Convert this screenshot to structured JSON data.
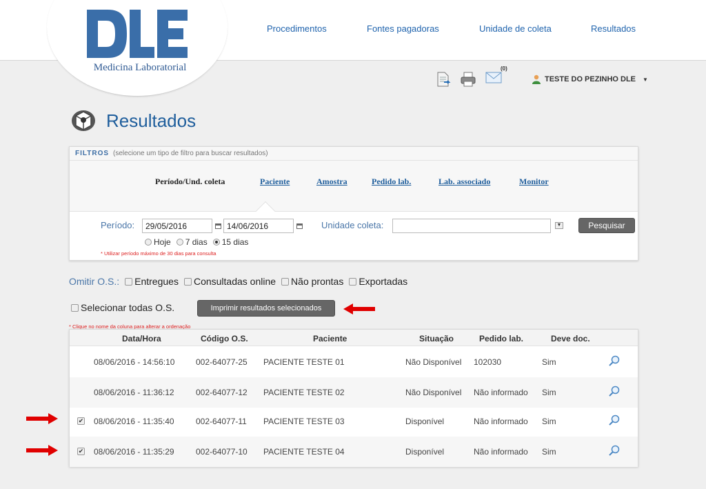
{
  "logo": {
    "text": "DLE",
    "subtitle": "Medicina Laboratorial",
    "color": "#3a6ea9"
  },
  "nav": [
    "Procedimentos",
    "Fontes pagadoras",
    "Unidade de coleta",
    "Resultados"
  ],
  "toolbar": {
    "messages_count": "(0)"
  },
  "user": {
    "name": "TESTE DO PEZINHO DLE"
  },
  "page": {
    "title": "Resultados"
  },
  "filters": {
    "heading": "FILTROS",
    "hint": "(selecione um tipo de filtro para buscar resultados)",
    "tabs": [
      "Período/Und. coleta",
      "Paciente",
      "Amostra",
      "Pedido lab.",
      "Lab. associado",
      "Monitor"
    ],
    "active_tab": "Período/Und. coleta",
    "period_label": "Período:",
    "date_from": "29/05/2016",
    "date_to": "14/06/2016",
    "unit_label": "Unidade coleta:",
    "unit_value": "",
    "search_button": "Pesquisar",
    "quick_ranges": [
      "Hoje",
      "7 dias",
      "15 dias"
    ],
    "quick_selected": "15 dias",
    "period_note": "* Utilizar período máximo de 30 dias para consulta"
  },
  "omit": {
    "label": "Omitir O.S.:",
    "options": [
      "Entregues",
      "Consultadas online",
      "Não prontas",
      "Exportadas"
    ]
  },
  "select_all_label": "Selecionar todas O.S.",
  "print_button": "Imprimir resultados selecionados",
  "sort_note": "* Clique no nome da coluna para alterar a ordenação",
  "table": {
    "columns": [
      "Data/Hora",
      "Código O.S.",
      "Paciente",
      "Situação",
      "Pedido lab.",
      "Deve doc."
    ],
    "rows": [
      {
        "datetime": "08/06/2016 - 14:56:10",
        "code": "002-64077-25",
        "patient": "PACIENTE TESTE 01",
        "status": "Não Disponível",
        "order": "102030",
        "doc": "Sim",
        "selectable": false,
        "checked": false
      },
      {
        "datetime": "08/06/2016 - 11:36:12",
        "code": "002-64077-12",
        "patient": "PACIENTE TESTE 02",
        "status": "Não Disponível",
        "order": "Não informado",
        "doc": "Sim",
        "selectable": false,
        "checked": false
      },
      {
        "datetime": "08/06/2016 - 11:35:40",
        "code": "002-64077-11",
        "patient": "PACIENTE TESTE 03",
        "status": "Disponível",
        "order": "Não informado",
        "doc": "Sim",
        "selectable": true,
        "checked": true
      },
      {
        "datetime": "08/06/2016 - 11:35:29",
        "code": "002-64077-10",
        "patient": "PACIENTE TESTE 04",
        "status": "Disponível",
        "order": "Não informado",
        "doc": "Sim",
        "selectable": true,
        "checked": true
      }
    ]
  },
  "icons": [
    "document-export-icon",
    "printer-icon",
    "envelope-icon",
    "user-icon",
    "caret-down-icon",
    "results-logo-icon",
    "calendar-icon",
    "magnifier-icon",
    "red-arrow-icon"
  ],
  "colors": {
    "brand": "#3a6ea9",
    "link": "#1f63ad",
    "arrow": "#e00000",
    "button": "#666666"
  }
}
